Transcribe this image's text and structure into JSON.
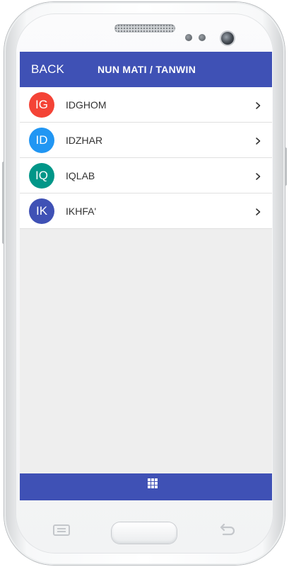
{
  "app_bar": {
    "back_label": "BACK",
    "title": "NUN MATI / TANWIN",
    "background": "#3f51b5"
  },
  "list": {
    "items": [
      {
        "initials": "IG",
        "label": "IDGHOM",
        "avatar_color": "#f44336"
      },
      {
        "initials": "ID",
        "label": "IDZHAR",
        "avatar_color": "#2196f3"
      },
      {
        "initials": "IQ",
        "label": "IQLAB",
        "avatar_color": "#009688"
      },
      {
        "initials": "IK",
        "label": "IKHFA'",
        "avatar_color": "#3f51b5"
      }
    ],
    "trailing_icon": "chevron-right-icon"
  },
  "bottom_bar": {
    "icon": "grid-menu-icon",
    "background": "#3f51b5"
  },
  "device": {
    "hardware_keys": [
      "menu-key-icon",
      "home-button",
      "back-key-icon"
    ]
  }
}
